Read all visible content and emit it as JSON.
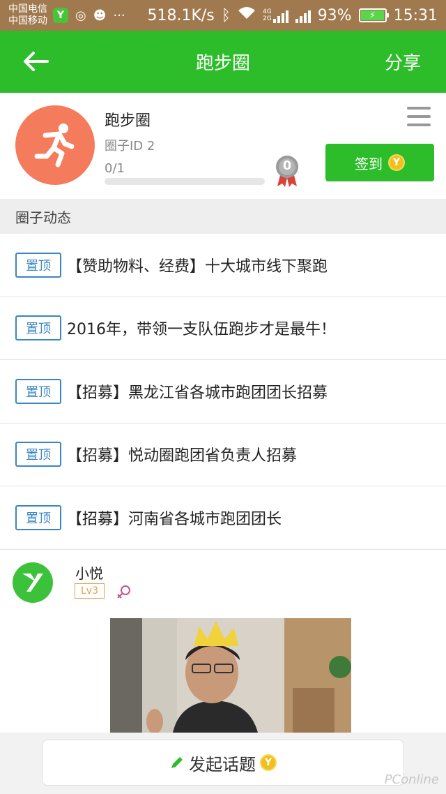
{
  "status_bar": {
    "carrier_1": "中国电信",
    "carrier_2": "中国移动",
    "net_speed": "518.1K/s",
    "net_type_1": "4G",
    "net_type_2": "2G",
    "battery": "93%",
    "time": "15:31"
  },
  "header": {
    "title": "跑步圈",
    "share_label": "分享"
  },
  "circle": {
    "name": "跑步圈",
    "id_label": "圈子ID 2",
    "progress_text": "0/1",
    "progress_fraction": 0,
    "medal_count": "0",
    "checkin_label": "签到",
    "coin_symbol": "Y"
  },
  "section": {
    "title": "圈子动态"
  },
  "pinned": [
    {
      "tag": "置顶",
      "title": "【赞助物料、经费】十大城市线下聚跑"
    },
    {
      "tag": "置顶",
      "title": "2016年，带领一支队伍跑步才是最牛！"
    },
    {
      "tag": "置顶",
      "title": "【招募】黑龙江省各城市跑团团长招募"
    },
    {
      "tag": "置顶",
      "title": "【招募】悦动圈跑团省负责人招募"
    },
    {
      "tag": "置顶",
      "title": "【招募】河南省各城市跑团团长"
    }
  ],
  "post": {
    "user": "小悦",
    "level": "Lv3"
  },
  "bottom": {
    "new_topic_label": "发起话题",
    "coin_symbol": "Y"
  },
  "colors": {
    "brand_green": "#2dbd2a",
    "avatar_orange": "#f57b5d",
    "pin_blue": "#3a86c4",
    "level_orange": "#e59f4c",
    "coin_gold": "#f2c01c"
  }
}
